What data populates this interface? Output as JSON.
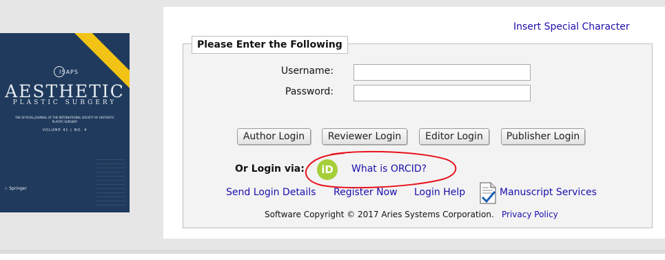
{
  "cover": {
    "logo": "ISAPS",
    "title": "AESTHETIC",
    "subtitle": "PLASTIC SURGERY",
    "description": "THE OFFICIAL JOURNAL OF THE INTERNATIONAL SOCIETY OF AESTHETIC PLASTIC SURGERY",
    "volume": "VOLUME 41 | NO. 4",
    "publisher": "Springer",
    "colors": {
      "background": "#1f3a5c",
      "ribbon": "#f2c314"
    }
  },
  "header": {
    "special_character_link": "Insert Special Character"
  },
  "form": {
    "legend": "Please Enter the Following",
    "username_label": "Username:",
    "username_value": "",
    "password_label": "Password:",
    "password_value": ""
  },
  "buttons": {
    "author": "Author Login",
    "reviewer": "Reviewer Login",
    "editor": "Editor Login",
    "publisher": "Publisher Login"
  },
  "orcid": {
    "or_login_label": "Or Login via:",
    "icon_text": "iD",
    "what_is_link": "What is ORCID?",
    "icon_color": "#a6ce39",
    "annotation_color": "#e8101a"
  },
  "links": {
    "send_login": "Send Login Details",
    "register": "Register Now",
    "login_help": "Login Help",
    "manuscript_services": "Manuscript Services"
  },
  "footer": {
    "copyright": "Software Copyright © 2017 Aries Systems Corporation.",
    "privacy": "Privacy Policy"
  },
  "colors": {
    "link": "#1a0dab",
    "panel_bg": "#f3f3f3",
    "page_bg": "#e6e6e6"
  }
}
